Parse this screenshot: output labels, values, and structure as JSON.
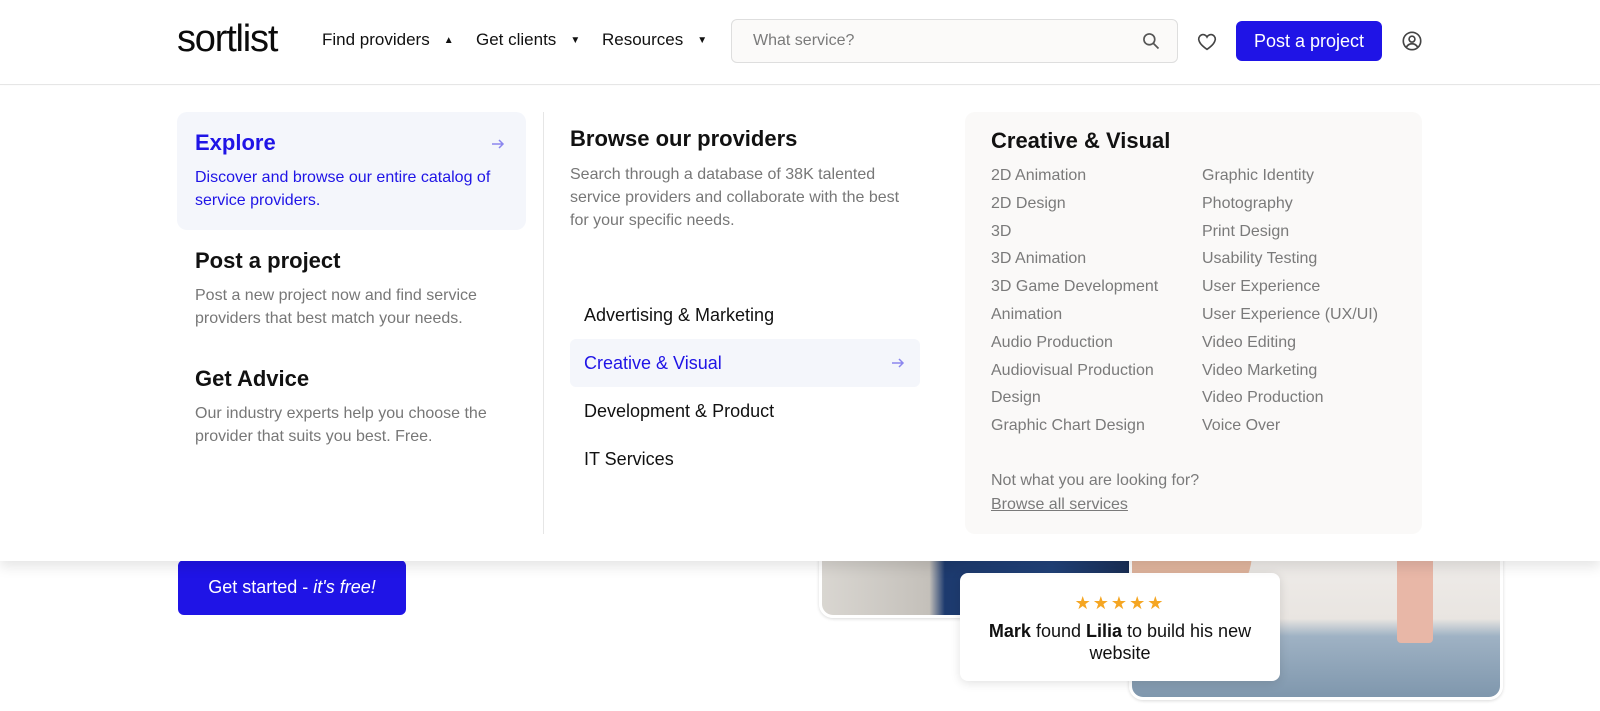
{
  "header": {
    "logo": "sortlist",
    "nav": [
      {
        "label": "Find providers",
        "caret": "▲"
      },
      {
        "label": "Get clients",
        "caret": "▼"
      },
      {
        "label": "Resources",
        "caret": "▼"
      }
    ],
    "search_placeholder": "What service?",
    "post_button": "Post a project"
  },
  "menu": {
    "left": [
      {
        "title": "Explore",
        "desc": "Discover and browse our entire catalog of service providers."
      },
      {
        "title": "Post a project",
        "desc": "Post a new project now and find service providers that best match your needs."
      },
      {
        "title": "Get Advice",
        "desc": "Our industry experts help you choose the provider that suits you best. Free."
      }
    ],
    "middle": {
      "title": "Browse our providers",
      "desc": "Search through a database of 38K talented service providers and collaborate with the best for your specific needs.",
      "categories": [
        "Advertising & Marketing",
        "Creative & Visual",
        "Development & Product",
        "IT Services"
      ]
    },
    "right": {
      "title": "Creative & Visual",
      "col1": [
        "2D Animation",
        "2D Design",
        "3D",
        "3D Animation",
        "3D Game Development",
        "Animation",
        "Audio Production",
        "Audiovisual Production",
        "Design",
        "Graphic Chart Design"
      ],
      "col2": [
        "Graphic Identity",
        "Photography",
        "Print Design",
        "Usability Testing",
        "User Experience",
        "User Experience (UX/UI)",
        "Video Editing",
        "Video Marketing",
        "Video Production",
        "Voice Over"
      ],
      "not_found": "Not what you are looking for?",
      "browse_all": "Browse all services"
    }
  },
  "hero": {
    "cta_main": "Get started - ",
    "cta_em": "it's free!",
    "stars": "★★★★★",
    "review": {
      "name1": "Mark",
      "mid": " found ",
      "name2": "Lilia",
      "rest": " to build his new website"
    }
  },
  "colors": {
    "accent": "#1f14e6",
    "star": "#f5a623",
    "muted": "#7a7a7a"
  }
}
